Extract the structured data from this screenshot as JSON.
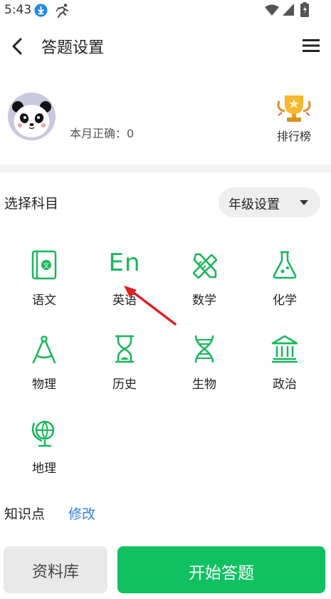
{
  "status_bar": {
    "time": "5:43"
  },
  "app_bar": {
    "title": "答题设置"
  },
  "profile": {
    "monthly_correct": "本月正确：0",
    "leaderboard_label": "排行榜"
  },
  "subjects_section": {
    "title": "选择科目",
    "grade_button": "年级设置",
    "subjects": [
      {
        "label": "语文",
        "icon": "book-icon"
      },
      {
        "label": "英语",
        "icon": "english-icon",
        "icon_text": "En"
      },
      {
        "label": "数学",
        "icon": "ruler-pencil-icon"
      },
      {
        "label": "化学",
        "icon": "flask-icon"
      },
      {
        "label": "物理",
        "icon": "compass-icon"
      },
      {
        "label": "历史",
        "icon": "hourglass-icon"
      },
      {
        "label": "生物",
        "icon": "dna-icon"
      },
      {
        "label": "政治",
        "icon": "government-building-icon"
      },
      {
        "label": "地理",
        "icon": "globe-icon"
      }
    ]
  },
  "knowledge": {
    "label": "知识点",
    "modify": "修改"
  },
  "bottom": {
    "library": "资料库",
    "start": "开始答题"
  },
  "colors": {
    "accent_green": "#0fc160",
    "icon_green": "#18b55a",
    "link_blue": "#2f7ee0",
    "annotation_red": "#e02020"
  }
}
